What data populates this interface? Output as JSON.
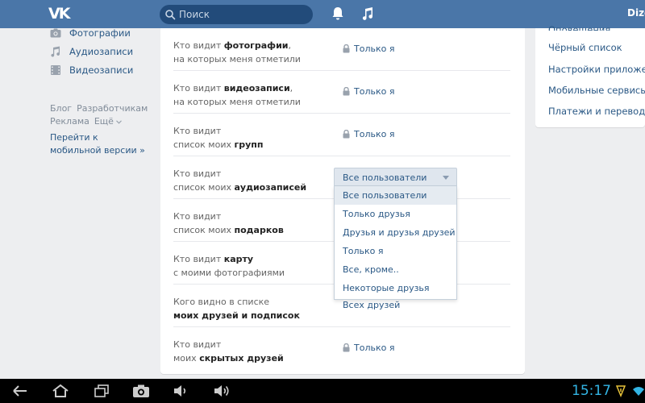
{
  "header": {
    "logo": "VK",
    "search_placeholder": "Поиск",
    "user_name": "Dize"
  },
  "left_menu": {
    "items": [
      {
        "label": "Фотографии",
        "icon": "camera-icon"
      },
      {
        "label": "Аудиозаписи",
        "icon": "music-note-icon"
      },
      {
        "label": "Видеозаписи",
        "icon": "film-icon"
      }
    ],
    "links": {
      "blog": "Блог",
      "developers": "Разработчикам",
      "ads": "Реклама",
      "more": "Ещё"
    },
    "mobile_link": "Перейти к мобильной версии »"
  },
  "privacy_rows": [
    {
      "label_pre": "Кто видит ",
      "label_bold": "фотографии",
      "label_post": ",",
      "label_line2": "на которых меня отметили",
      "label_line2_bold": "",
      "value": "Только я",
      "locked": true
    },
    {
      "label_pre": "Кто видит ",
      "label_bold": "видеозаписи",
      "label_post": ",",
      "label_line2": "на которых меня отметили",
      "label_line2_bold": "",
      "value": "Только я",
      "locked": true
    },
    {
      "label_pre": "Кто видит",
      "label_bold": "",
      "label_post": "",
      "label_line2": "список моих ",
      "label_line2_bold": "групп",
      "value": "Только я",
      "locked": true
    },
    {
      "label_pre": "Кто видит",
      "label_bold": "",
      "label_post": "",
      "label_line2": "список моих ",
      "label_line2_bold": "аудиозаписей",
      "value": "",
      "locked": false
    },
    {
      "label_pre": "Кто видит",
      "label_bold": "",
      "label_post": "",
      "label_line2": "список моих ",
      "label_line2_bold": "подарков",
      "value": "",
      "locked": false
    },
    {
      "label_pre": "Кто видит ",
      "label_bold": "карту",
      "label_post": "",
      "label_line2": "с моими фотографиями",
      "label_line2_bold": "",
      "value": "",
      "locked": false
    },
    {
      "label_pre": "Кого видно в списке",
      "label_bold": "",
      "label_post": "",
      "label_line2": "",
      "label_line2_bold": "моих друзей и подписок",
      "value": "Всех друзей",
      "locked": false
    },
    {
      "label_pre": "Кто видит",
      "label_bold": "",
      "label_post": "",
      "label_line2": "моих ",
      "label_line2_bold": "скрытых друзей",
      "value": "Только я",
      "locked": true
    }
  ],
  "dropdown": {
    "selected": "Все пользователи",
    "options": [
      "Все пользователи",
      "Только друзья",
      "Друзья и друзья друзей",
      "Только я",
      "Все, кроме..",
      "Некоторые друзья"
    ]
  },
  "right_menu": {
    "items": [
      "Оповещения",
      "Чёрный список",
      "Настройки приложений",
      "Мобильные сервисы",
      "Платежи и переводы"
    ]
  },
  "status_bar": {
    "time": "15:17"
  },
  "colors": {
    "header": "#4a76a8",
    "link": "#2a5885",
    "clock": "#33b5e5"
  }
}
